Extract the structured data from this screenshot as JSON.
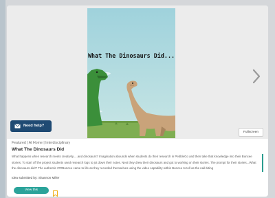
{
  "slide": {
    "title": "What The Dinosaurs Did..."
  },
  "viewer": {
    "fullscreen_label": "Fullscreen",
    "next_icon": "chevron-right-icon"
  },
  "help": {
    "label": "Need help?",
    "icon": "mail-icon"
  },
  "idea": {
    "tags": "Featured | At Home | Interdisciplinary",
    "title": "What The Dinosaurs Did",
    "description": "What happens when research meets creativity.....and dinosaurs? Imagination abounds when students do their research in PebbleGo and then take that knowledge into their Buncee stories. To start off the project students used research logs to jot down their notes. Next they drew their dinosaurs and got to working on their stories. The prompt for their stories...What the dinosaurs did!? The authentic ###Buncee came to life as they recorded themselves using the video capability within Buncee to tell as the nail-biting",
    "credit": "Idea submitted by: Shannon Miller",
    "view_label": "View this",
    "bookmark_icon": "bookmark-icon"
  },
  "colors": {
    "accent": "#2aa39a",
    "help_bg": "#1f4a73",
    "bookmark": "#f2b01e"
  }
}
